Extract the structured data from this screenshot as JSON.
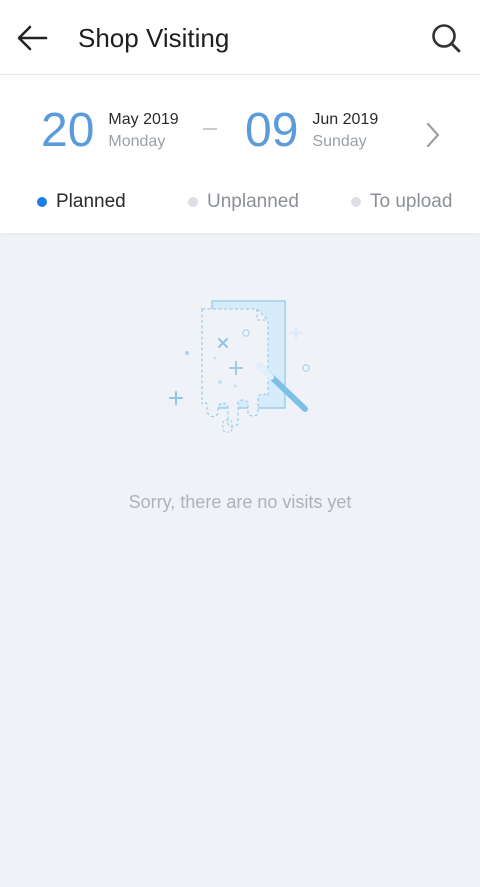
{
  "header": {
    "title": "Shop Visiting",
    "back_icon": "arrow-left-icon",
    "search_icon": "search-icon"
  },
  "date_range": {
    "start": {
      "day": "20",
      "month_year": "May 2019",
      "weekday": "Monday"
    },
    "separator": "–",
    "end": {
      "day": "09",
      "month_year": "Jun 2019",
      "weekday": "Sunday"
    },
    "next_icon": "chevron-right-icon"
  },
  "tabs": [
    {
      "label": "Planned",
      "active": true
    },
    {
      "label": "Unplanned",
      "active": false
    },
    {
      "label": "To upload",
      "active": false
    }
  ],
  "empty_state": {
    "icon": "no-data-illustration-icon",
    "message": "Sorry, there are no visits yet"
  },
  "colors": {
    "accent": "#5b9bdc",
    "active_dot": "#1e7ce8",
    "inactive_dot": "#dcdfe3",
    "background": "#eff2f6"
  }
}
